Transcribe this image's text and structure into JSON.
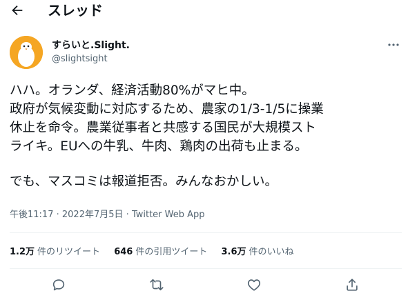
{
  "header": {
    "back_icon": "arrow-left-icon",
    "title": "スレッド"
  },
  "author": {
    "name": "すらいと.Slight.",
    "handle": "@slightsight",
    "avatar_color": "#f5a623"
  },
  "tweet": {
    "lines": [
      "ハハ。オランダ、経済活動80%がマヒ中。",
      "政府が気候変動に対応するため、農家の1/3-1/5に操業",
      "休止を命令。農業従事者と共感する国民が大規模スト",
      "ライキ。EUへの牛乳、牛肉、鶏肉の出荷も止まる。",
      "",
      "でも、マスコミは報道拒否。みんなおかしい。"
    ],
    "time": "午後11:17",
    "separator": "·",
    "date": "2022年7月5日",
    "source": "Twitter Web App"
  },
  "stats": {
    "retweets_count": "1.2万",
    "retweets_label": "件のリツイート",
    "quotes_count": "646",
    "quotes_label": "件の引用ツイート",
    "likes_count": "3.6万",
    "likes_label": "件のいいね"
  },
  "actions": {
    "reply_icon": "reply-icon",
    "retweet_icon": "retweet-icon",
    "like_icon": "heart-icon",
    "share_icon": "share-icon"
  },
  "colors": {
    "text": "#0f1419",
    "secondary": "#536471",
    "divider": "#eff3f4"
  }
}
